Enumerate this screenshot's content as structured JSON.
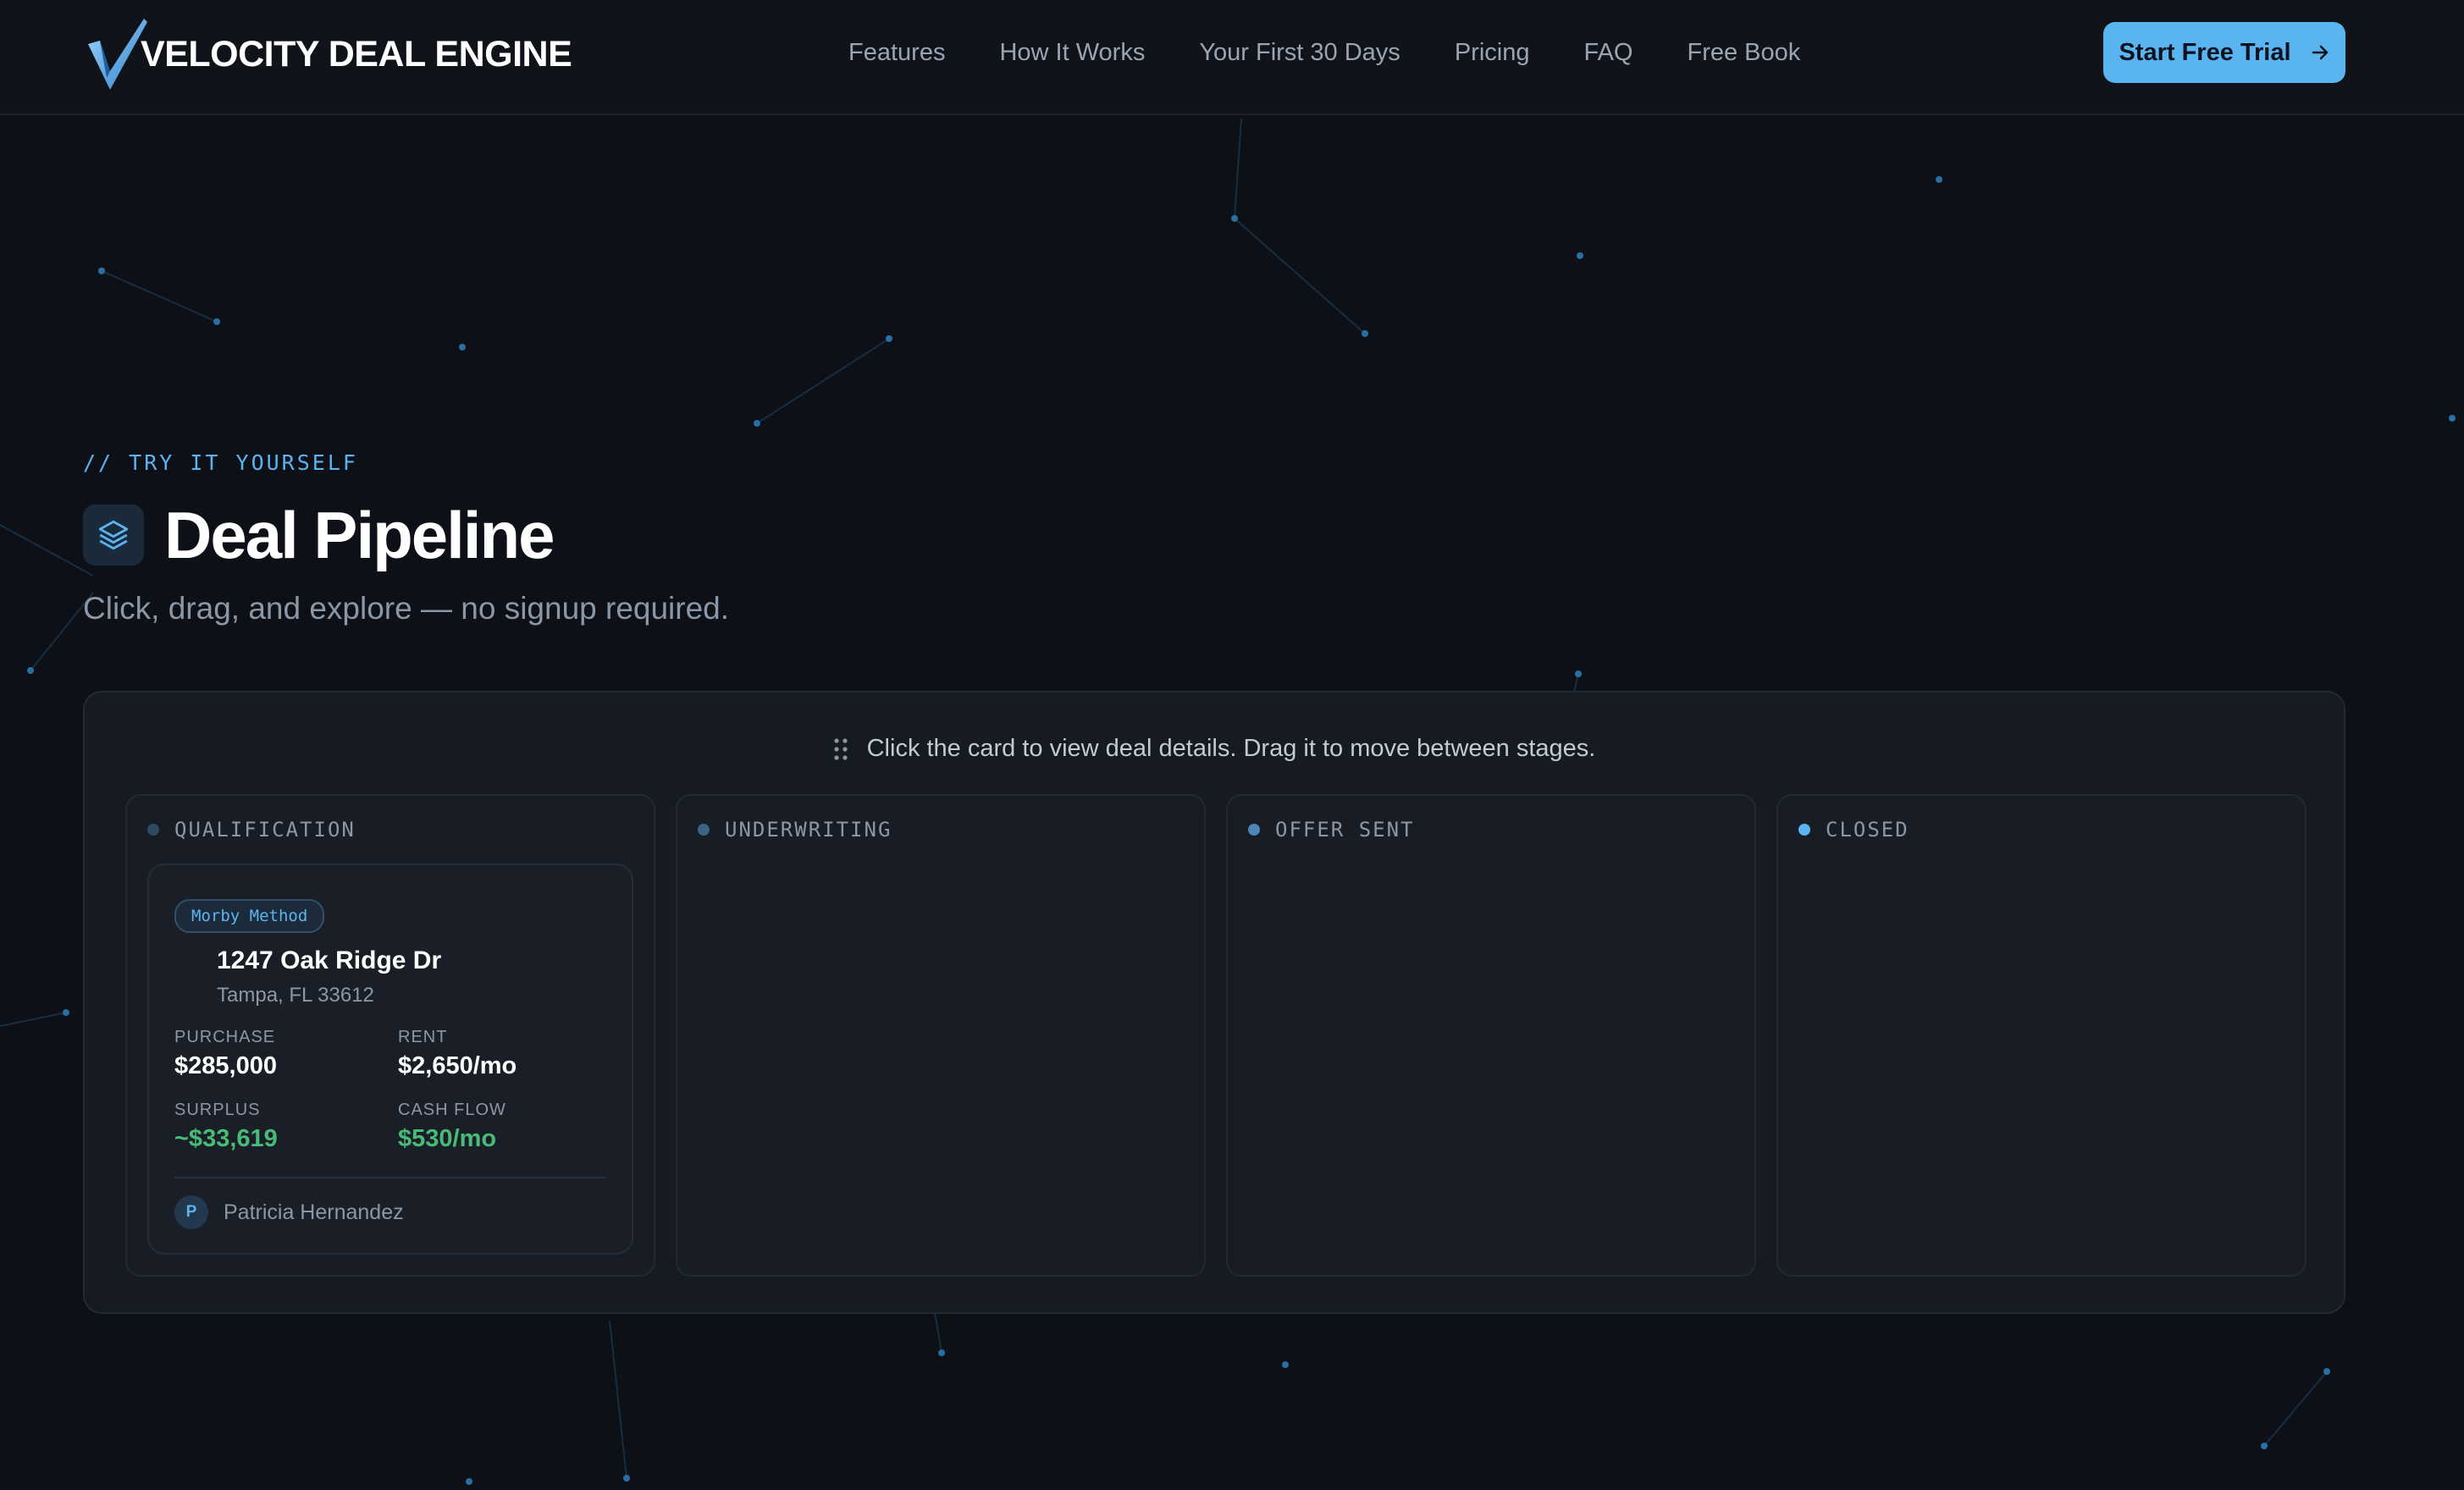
{
  "header": {
    "brand_name": "VELOCITY DEAL ENGINE",
    "logo_icon": "v-check-logo",
    "nav_links": [
      "Features",
      "How It Works",
      "Your First 30 Days",
      "Pricing",
      "FAQ",
      "Free Book"
    ],
    "cta_label": "Start Free Trial",
    "cta_icon": "arrow-right-icon"
  },
  "intro": {
    "eyebrow": "// TRY IT YOURSELF",
    "title_icon": "layers-icon",
    "title": "Deal Pipeline",
    "subtitle": "Click, drag, and explore — no signup required."
  },
  "board": {
    "hint_icon": "drag-handle-icon",
    "hint": "Click the card to view deal details. Drag it to move between stages.",
    "columns": [
      {
        "label": "QUALIFICATION",
        "dot_color": "#2f4a63"
      },
      {
        "label": "UNDERWRITING",
        "dot_color": "#3b6587"
      },
      {
        "label": "OFFER SENT",
        "dot_color": "#4a86b8"
      },
      {
        "label": "CLOSED",
        "dot_color": "#5ab4f0"
      }
    ],
    "card": {
      "badge": "Morby Method",
      "address": "1247 Oak Ridge Dr",
      "city": "Tampa, FL 33612",
      "purchase_label": "PURCHASE",
      "purchase": "$285,000",
      "rent_label": "RENT",
      "rent": "$2,650/mo",
      "surplus_label": "SURPLUS",
      "surplus": "~$33,619",
      "cashflow_label": "CASH FLOW",
      "cashflow": "$530/mo",
      "owner_initial": "P",
      "owner": "Patricia Hernandez"
    }
  },
  "colors": {
    "background": "#0d1117",
    "accent": "#5ab4f0",
    "positive": "#48bb78",
    "panel": "#161b22"
  }
}
